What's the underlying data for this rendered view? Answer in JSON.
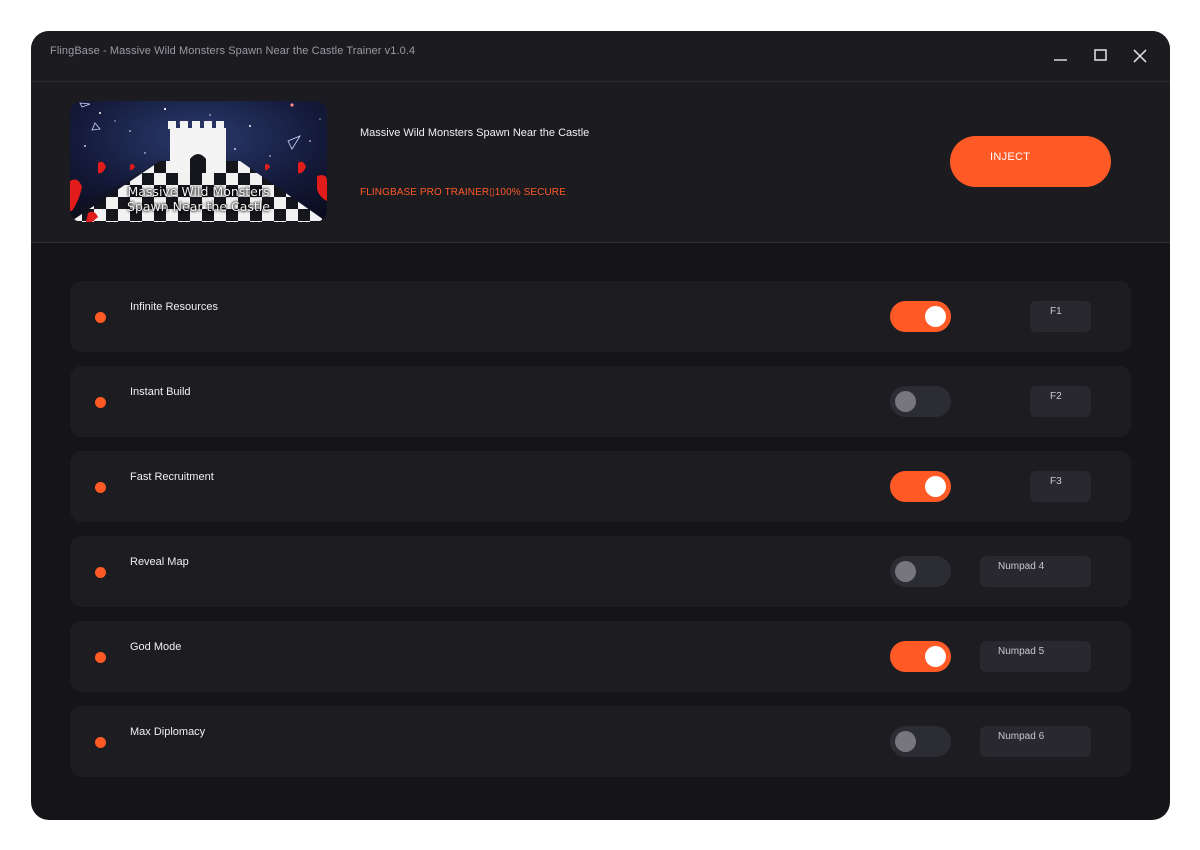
{
  "window": {
    "title": "FlingBase - Massive Wild Monsters Spawn Near the Castle Trainer v1.0.4",
    "controls": [
      "minimize-icon",
      "maximize-icon",
      "close-icon"
    ]
  },
  "header": {
    "cover_caption_line1": "Massive Wild Monsters",
    "cover_caption_line2": "Spawn Near the Castle",
    "game_title": "Massive Wild Monsters Spawn Near the Castle",
    "subtitle": "FLINGBASE PRO TRAINER▯100% SECURE",
    "inject_label": "INJECT"
  },
  "colors": {
    "accent": "#ff5a26",
    "background": "#141419",
    "panel": "#1c1c21"
  },
  "cheats": [
    {
      "label": "Infinite Resources",
      "enabled": true,
      "hotkey": "F1"
    },
    {
      "label": "Instant Build",
      "enabled": false,
      "hotkey": "F2"
    },
    {
      "label": "Fast Recruitment",
      "enabled": true,
      "hotkey": "F3"
    },
    {
      "label": "Reveal Map",
      "enabled": false,
      "hotkey": "Numpad 4"
    },
    {
      "label": "God Mode",
      "enabled": true,
      "hotkey": "Numpad 5"
    },
    {
      "label": "Max Diplomacy",
      "enabled": false,
      "hotkey": "Numpad 6"
    }
  ]
}
